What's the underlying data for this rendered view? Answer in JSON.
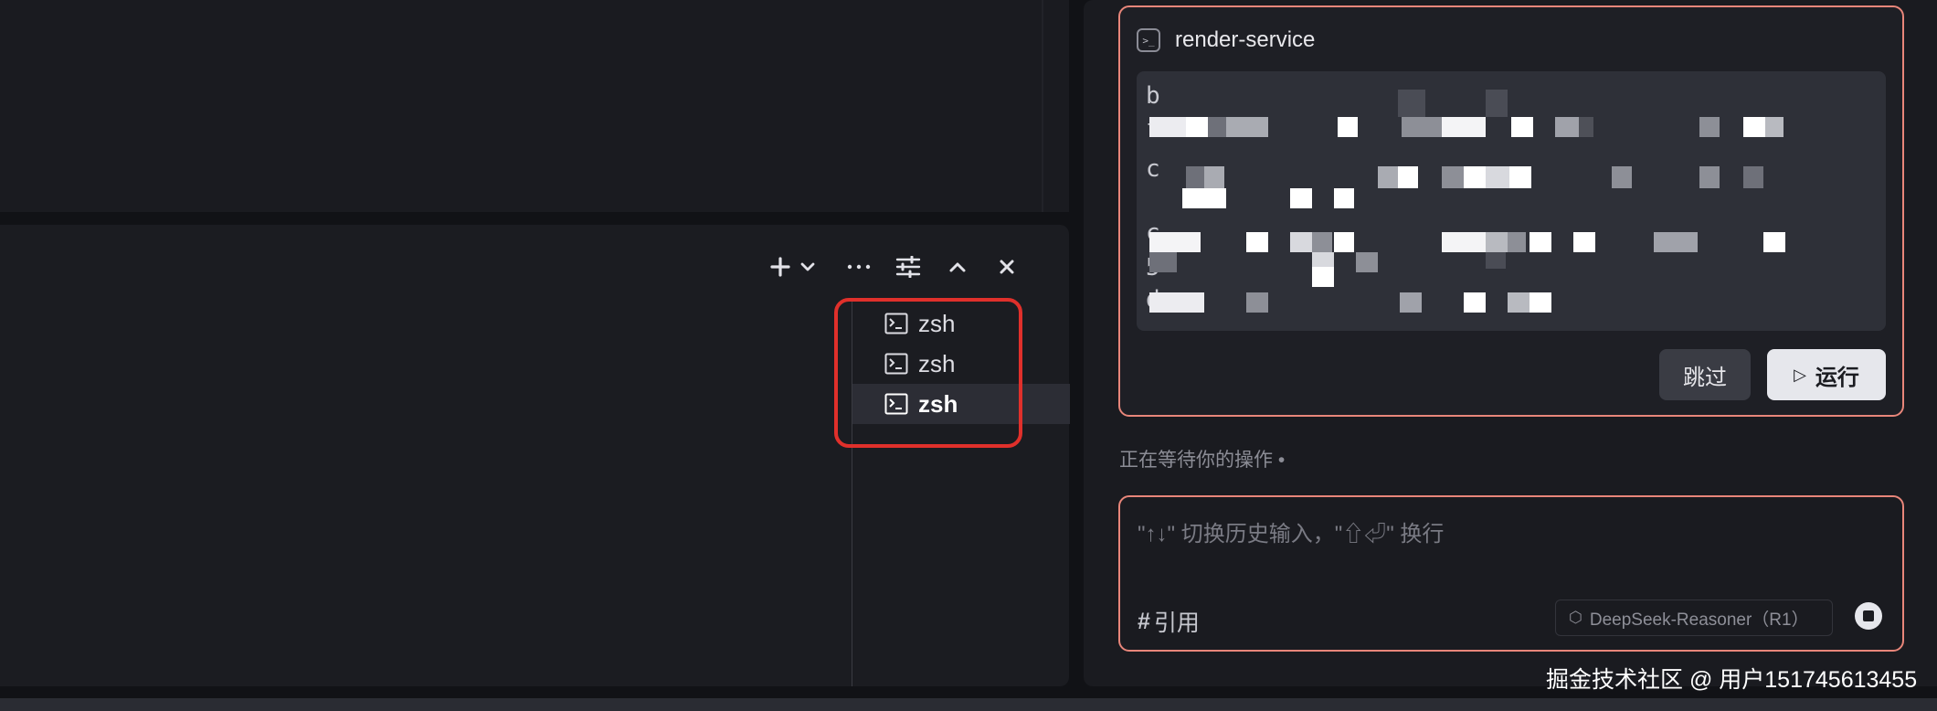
{
  "terminal": {
    "toolbar": {
      "add_icon": "plus-icon",
      "dropdown_icon": "chevron-down-icon",
      "more_icon": "ellipsis-icon",
      "settings_icon": "sliders-icon",
      "maximize_icon": "chevron-up-icon",
      "close_icon": "close-icon"
    },
    "sessions": [
      {
        "label": "zsh",
        "active": false
      },
      {
        "label": "zsh",
        "active": false
      },
      {
        "label": "zsh",
        "active": true
      }
    ]
  },
  "chat": {
    "tool_card": {
      "service_name": "render-service",
      "skip_label": "跳过",
      "run_label": "运行"
    },
    "waiting_text": "正在等待你的操作 •",
    "input": {
      "placeholder": "\"↑↓\" 切换历史输入，\"⇧⏎\" 换行",
      "reference_label": "引用",
      "model_label": "DeepSeek-Reasoner（R1）"
    }
  },
  "watermark": "掘金技术社区 @ 用户151745613455",
  "colors": {
    "accent_border": "#e8867a",
    "highlight_box": "#e0302b"
  }
}
